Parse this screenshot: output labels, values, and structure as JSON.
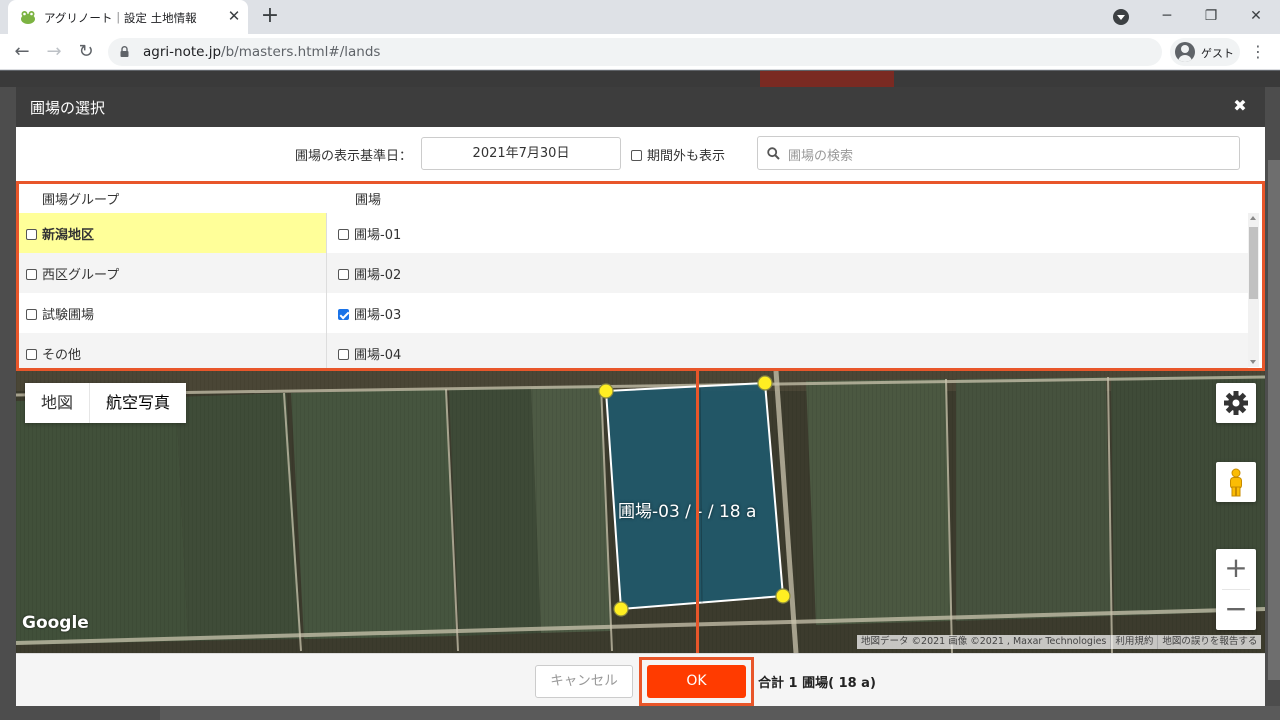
{
  "browser": {
    "tab_title": "アグリノート｜設定 土地情報",
    "url_domain": "agri-note.jp",
    "url_path": "/b/masters.html#/lands",
    "profile_label": "ゲスト"
  },
  "modal": {
    "title": "圃場の選択",
    "date_label": "圃場の表示基準日：",
    "date_value": "2021年7月30日",
    "out_of_period_label": "期間外も表示",
    "out_of_period_checked": false,
    "search_placeholder": "圃場の検索",
    "columns": {
      "group": "圃場グループ",
      "field": "圃場"
    },
    "rows": [
      {
        "group": "新潟地区",
        "group_checked": false,
        "group_highlight": true,
        "field": "圃場-01",
        "field_checked": false
      },
      {
        "group": "西区グループ",
        "group_checked": false,
        "group_highlight": false,
        "field": "圃場-02",
        "field_checked": false
      },
      {
        "group": "試験圃場",
        "group_checked": false,
        "group_highlight": false,
        "field": "圃場-03",
        "field_checked": true
      },
      {
        "group": "その他",
        "group_checked": false,
        "group_highlight": false,
        "field": "圃場-04",
        "field_checked": false
      }
    ],
    "map": {
      "type_buttons": [
        "地図",
        "航空写真"
      ],
      "active_type": "航空写真",
      "selected_field_label": "圃場-03 / - / 18 a",
      "google_logo": "Google",
      "attribution": [
        "地図データ ©2021 画像 ©2021 , Maxar Technologies",
        "利用規約",
        "地図の誤りを報告する"
      ],
      "zoom_in": "+",
      "zoom_out": "−"
    },
    "footer": {
      "cancel_label": "キャンセル",
      "ok_label": "OK",
      "total_text": "合計 1 圃場( 18 a)"
    }
  },
  "colors": {
    "highlight_outline": "#e8562a",
    "ok_button": "#ff3b00",
    "selected_group_bg": "#ffff99",
    "field_polygon": "#1f5a6e"
  }
}
